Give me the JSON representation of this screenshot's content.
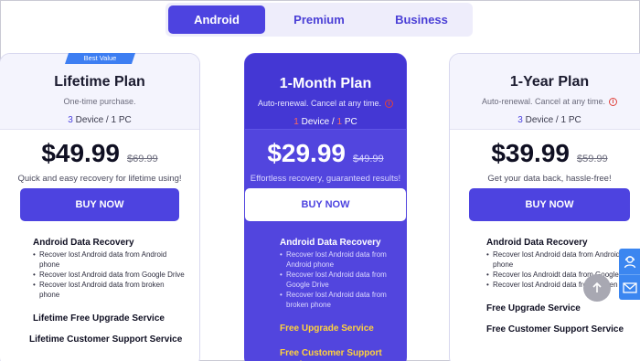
{
  "tabs": [
    {
      "label": "Android",
      "active": true
    },
    {
      "label": "Premium",
      "active": false
    },
    {
      "label": "Business",
      "active": false
    }
  ],
  "badge": "Best Value",
  "plans": [
    {
      "name": "Lifetime Plan",
      "description": "One-time purchase.",
      "device_count": "3",
      "device_text": " Device / ",
      "pc_count": "1",
      "pc_text": " PC",
      "price": "$49.99",
      "old_price": "$69.99",
      "tagline": "Quick and easy recovery for lifetime using!",
      "button": "BUY NOW",
      "feature_title": "Android Data Recovery",
      "bullets": [
        "Recover lost Android data from Android phone",
        "Recover lost Android data from Google Drive",
        "Recover lost Android data from broken phone"
      ],
      "extras": [
        "Lifetime Free Upgrade Service",
        "Lifetime Customer Support Service"
      ]
    },
    {
      "name": "1-Month Plan",
      "description": "Auto-renewal. Cancel at any time.",
      "device_count": "1",
      "device_text": " Device / ",
      "pc_count": "1",
      "pc_text": " PC",
      "price": "$29.99",
      "old_price": "$49.99",
      "tagline": "Effortless recovery, guaranteed results!",
      "button": "BUY NOW",
      "feature_title": "Android Data Recovery",
      "bullets": [
        "Recover lost Android data from Android phone",
        "Recover lost Android data from Google Drive",
        "Recover lost Android data from broken phone"
      ],
      "extras": [
        "Free Upgrade Service",
        "Free Customer Support Service"
      ]
    },
    {
      "name": "1-Year Plan",
      "description": "Auto-renewal. Cancel at any time.",
      "device_count": "3",
      "device_text": " Device / ",
      "pc_count": "1",
      "pc_text": " PC",
      "price": "$39.99",
      "old_price": "$59.99",
      "tagline": "Get your data back, hassle-free!",
      "button": "BUY NOW",
      "feature_title": "Android Data Recovery",
      "bullets": [
        "Recover lost Android data from Android phone",
        "Recover los Androidt data from Google Drive",
        "Recover lost Android data from broken phone"
      ],
      "extras": [
        "Free Upgrade Service",
        "Free Customer Support Service"
      ]
    }
  ],
  "icons": {
    "info": "info-icon",
    "scroll_top": "arrow-up-icon",
    "support": "customer-service-icon",
    "mail": "mail-icon"
  },
  "colors": {
    "accent": "#4d43e0",
    "highlight_card": "#5245de",
    "device_count": "#4d43e0",
    "pc_count": "#ff6a5c",
    "featured_extras": "#ffd23c",
    "badge": "#3d7ef2",
    "side_rail": "#3b86f0"
  }
}
